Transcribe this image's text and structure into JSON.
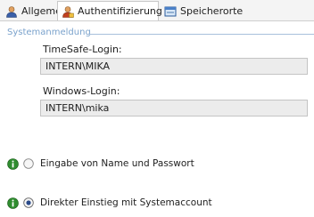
{
  "tabs": [
    {
      "label": "Allgemein",
      "icon": "user-icon"
    },
    {
      "label": "Authentifizierung",
      "icon": "user-lock-icon",
      "active": true
    },
    {
      "label": "Speicherorte",
      "icon": "storage-icon"
    }
  ],
  "group": {
    "label": "Systemanmeldung"
  },
  "timesafe": {
    "label": "TimeSafe-Login:",
    "value": "INTERN\\MIKA"
  },
  "windows": {
    "label": "Windows-Login:",
    "value": "INTERN\\mika"
  },
  "options": [
    {
      "label": "Eingabe von Name und Passwort",
      "selected": false
    },
    {
      "label": "Direkter Einstieg mit Systemaccount",
      "selected": true
    }
  ],
  "colors": {
    "accent": "#7aa2cc",
    "info": "#2f8c2f"
  }
}
